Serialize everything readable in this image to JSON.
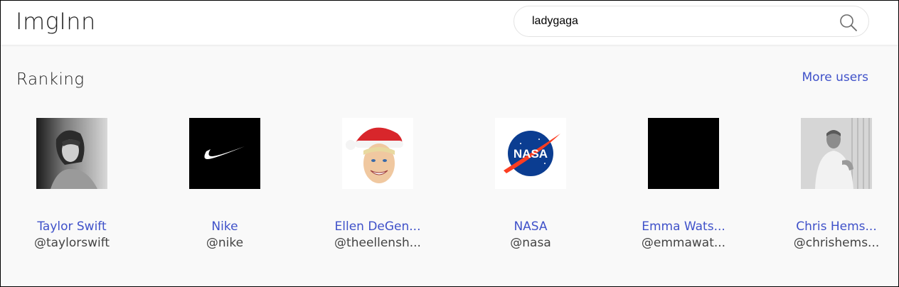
{
  "header": {
    "logo": "ImgInn",
    "search_value": "ladygaga"
  },
  "ranking": {
    "title": "Ranking",
    "more_label": "More users",
    "users": [
      {
        "name": "Taylor Swift",
        "handle": "@taylorswift"
      },
      {
        "name": "Nike",
        "handle": "@nike"
      },
      {
        "name": "Ellen DeGen...",
        "handle": "@theellensh..."
      },
      {
        "name": "NASA",
        "handle": "@nasa"
      },
      {
        "name": "Emma Wats...",
        "handle": "@emmawat..."
      },
      {
        "name": "Chris Hems...",
        "handle": "@chrishems..."
      }
    ]
  },
  "colors": {
    "link": "#3f51c9",
    "background": "#f9f9f9"
  }
}
